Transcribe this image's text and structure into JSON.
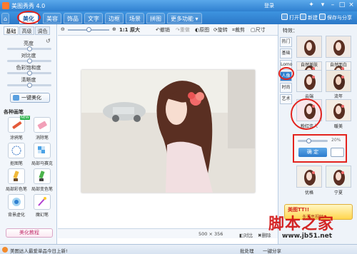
{
  "title": {
    "app": "美图秀秀 4.0",
    "account": "登录"
  },
  "menu": {
    "tabs": [
      "美化",
      "美容",
      "饰品",
      "文字",
      "边框",
      "场景",
      "拼图",
      "更多功能"
    ],
    "open": "打开",
    "new": "新建",
    "save": "保存与分享"
  },
  "left": {
    "subtabs": [
      "基础",
      "高级",
      "调色"
    ],
    "sliders": [
      {
        "label": "亮度",
        "value": 0.5
      },
      {
        "label": "对比度",
        "value": 0.5
      },
      {
        "label": "色彩饱和度",
        "value": 0.5
      },
      {
        "label": "清晰度",
        "value": 0.5
      }
    ],
    "auto": "一键美化",
    "section": "各种画笔",
    "tools": [
      "涂鸦笔",
      "消除笔",
      "抠图笔",
      "局部马赛克",
      "局部彩色笔",
      "局部变色笔",
      "背景虚化",
      "魔幻笔"
    ],
    "new_badge": "NEW",
    "tutorial": "美化教程"
  },
  "toolbar": {
    "zoom": "1:1 原大",
    "items": [
      "撤销",
      "重做",
      "原图",
      "旋转",
      "裁剪",
      "尺寸"
    ]
  },
  "status": {
    "size": "500 × 356",
    "compare": "对比",
    "delete": "删除"
  },
  "right": {
    "title": "特效：",
    "cats": [
      "热门",
      "基础",
      "Lomo",
      "人像",
      "时尚",
      "艺术"
    ],
    "effects": [
      "自然美肤",
      "自然而白",
      "云端",
      "流年",
      "粉红佳人",
      "暖美",
      "优格",
      "宁夏"
    ],
    "ok": "确 定",
    "pct": "20%",
    "ad_title": "美图TT!!",
    "ad_sub": "多漂亮视频"
  },
  "bottom": {
    "news": "美图达人最爱单品今日上新!",
    "b1": "批处理",
    "b2": "一键分享"
  },
  "watermark": {
    "text": "脚本之家",
    "url": "www.jb51.net"
  }
}
